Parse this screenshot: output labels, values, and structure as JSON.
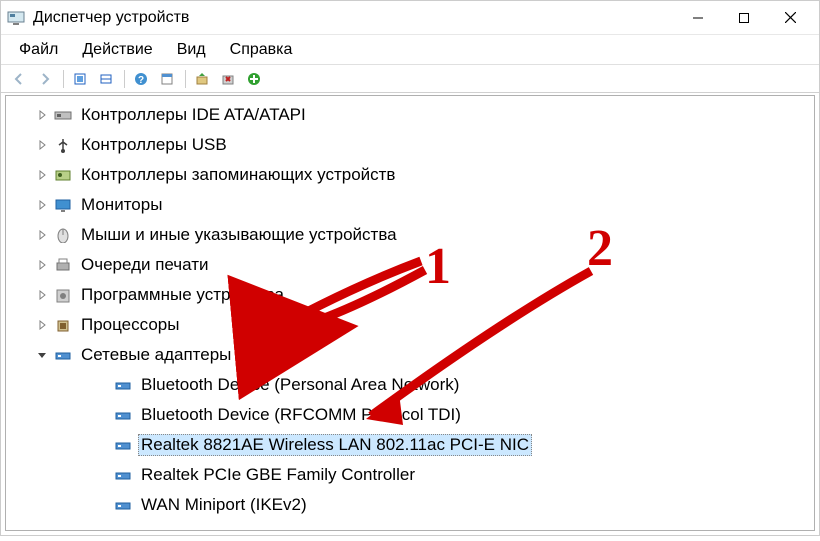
{
  "window": {
    "title": "Диспетчер устройств"
  },
  "menu": {
    "file": "Файл",
    "action": "Действие",
    "view": "Вид",
    "help": "Справка"
  },
  "toolbar": {
    "icons": [
      "back",
      "forward",
      "up",
      "show-hidden",
      "properties",
      "refresh",
      "update-driver",
      "uninstall",
      "disable",
      "scan-hardware"
    ]
  },
  "tree": {
    "categories": [
      {
        "label": "Контроллеры IDE ATA/ATAPI",
        "icon": "ide",
        "expanded": false
      },
      {
        "label": "Контроллеры USB",
        "icon": "usb",
        "expanded": false
      },
      {
        "label": "Контроллеры запоминающих устройств",
        "icon": "storage",
        "expanded": false
      },
      {
        "label": "Мониторы",
        "icon": "monitor",
        "expanded": false
      },
      {
        "label": "Мыши и иные указывающие устройства",
        "icon": "mouse",
        "expanded": false
      },
      {
        "label": "Очереди печати",
        "icon": "printer",
        "expanded": false
      },
      {
        "label": "Программные устройства",
        "icon": "software",
        "expanded": false
      },
      {
        "label": "Процессоры",
        "icon": "cpu",
        "expanded": false
      },
      {
        "label": "Сетевые адаптеры",
        "icon": "network",
        "expanded": true,
        "children": [
          {
            "label": "Bluetooth Device (Personal Area Network)",
            "icon": "netadapter",
            "selected": false
          },
          {
            "label": "Bluetooth Device (RFCOMM Protocol TDI)",
            "icon": "netadapter",
            "selected": false
          },
          {
            "label": "Realtek 8821AE Wireless LAN 802.11ac PCI-E NIC",
            "icon": "netadapter",
            "selected": true
          },
          {
            "label": "Realtek PCIe GBE Family Controller",
            "icon": "netadapter",
            "selected": false
          },
          {
            "label": "WAN Miniport (IKEv2)",
            "icon": "netadapter",
            "selected": false
          }
        ]
      }
    ]
  },
  "annotations": {
    "one": "1",
    "two": "2",
    "color": "#d00000"
  }
}
